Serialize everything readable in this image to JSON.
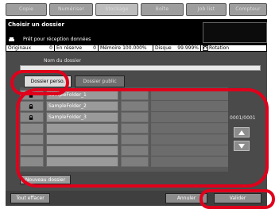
{
  "top_tabs": [
    {
      "label": "Copie"
    },
    {
      "label": "Numériser"
    },
    {
      "label": "Stockage"
    },
    {
      "label": "Boîte"
    },
    {
      "label": "Job list"
    },
    {
      "label": "Compteur"
    }
  ],
  "header": {
    "title": "Choisir un dossier",
    "status": "Prêt pour réception données"
  },
  "status_bar": {
    "originals_label": "Originaux",
    "originals_value": "0",
    "reserve_label": "En réserve",
    "reserve_value": "0",
    "memory_label": "Mémoire",
    "memory_value": "100.000%",
    "disk_label": "Disque",
    "disk_value": "99.999%",
    "rotation_label": "Rotation"
  },
  "folder_name": {
    "label": "Nom du dossier",
    "value": ""
  },
  "tabs": {
    "personal": "Dossier perso.",
    "public": "Dossier public"
  },
  "folders": [
    {
      "name": "SampleFolder_1",
      "locked": true
    },
    {
      "name": "SampleFolder_2",
      "locked": true
    },
    {
      "name": "SampleFolder_3",
      "locked": true
    },
    {
      "name": "",
      "locked": false
    },
    {
      "name": "",
      "locked": false
    },
    {
      "name": "",
      "locked": false
    },
    {
      "name": "",
      "locked": false
    }
  ],
  "pagination": {
    "text": "0001/0001"
  },
  "buttons": {
    "new_folder": "Nouveau dossier",
    "clear_all": "Tout effacer",
    "cancel": "Annuler",
    "validate": "Valider"
  },
  "colors": {
    "annotation": "#e0001b",
    "panel": "#4a4a4a",
    "header": "#000000"
  }
}
